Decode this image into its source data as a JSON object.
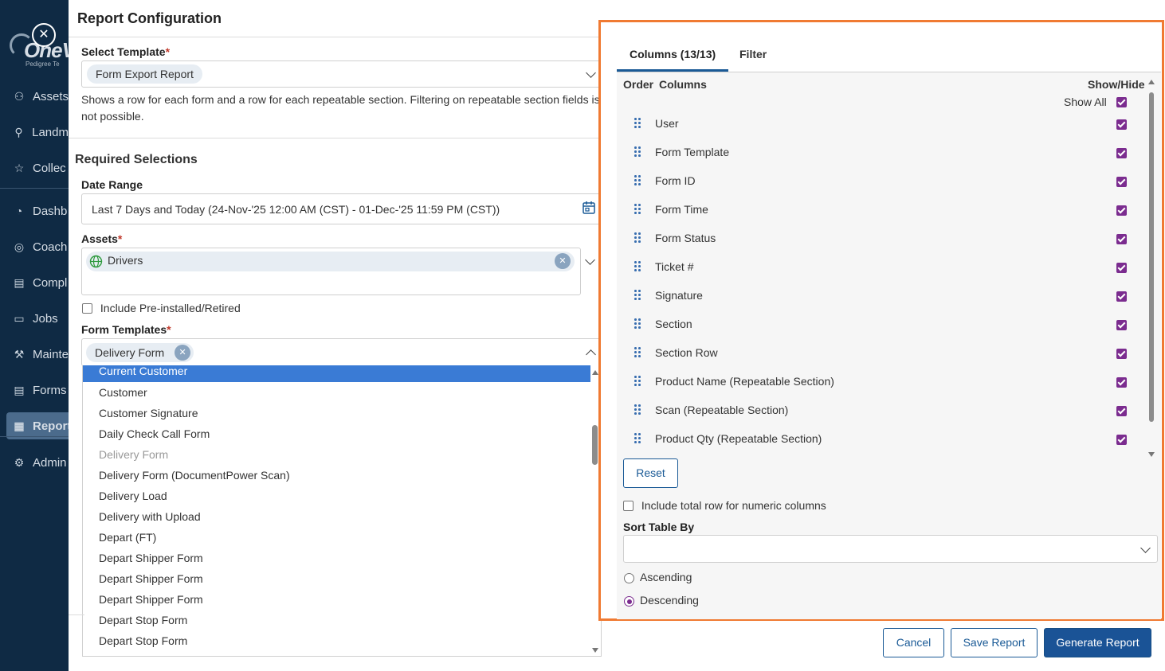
{
  "sidebar": {
    "brand": "OneV",
    "brand_sub": "Pedigree Te",
    "items": [
      {
        "label": "Assets",
        "icon": "assets-icon",
        "glyph": "⚇"
      },
      {
        "label": "Landm",
        "icon": "map-pin-icon",
        "glyph": "⚲"
      },
      {
        "label": "Collec",
        "icon": "star-icon",
        "glyph": "☆"
      },
      {
        "label": "Dashb",
        "icon": "dashboard-icon",
        "glyph": "◔"
      },
      {
        "label": "Coach",
        "icon": "coach-icon",
        "glyph": "◎"
      },
      {
        "label": "Compl",
        "icon": "clipboard-icon",
        "glyph": "▤"
      },
      {
        "label": "Jobs",
        "icon": "briefcase-icon",
        "glyph": "▭"
      },
      {
        "label": "Mainte",
        "icon": "wrench-icon",
        "glyph": "⚒"
      },
      {
        "label": "Forms",
        "icon": "forms-icon",
        "glyph": "▤"
      },
      {
        "label": "Report",
        "icon": "report-icon",
        "glyph": "▦"
      },
      {
        "label": "Admin",
        "icon": "admin-icon",
        "glyph": "⚙"
      }
    ]
  },
  "dialog": {
    "title": "Report Configuration",
    "template": {
      "label": "Select Template",
      "required": "*",
      "value": "Form Export Report",
      "description": "Shows a row for each form and a row for each repeatable section. Filtering on repeatable section fields is not possible."
    },
    "required_selections": "Required Selections",
    "date_range": {
      "label": "Date Range",
      "value": "Last 7 Days and Today (24-Nov-'25 12:00 AM (CST) - 01-Dec-'25 11:59 PM (CST))"
    },
    "assets": {
      "label": "Assets",
      "required": "*",
      "chip": "Drivers",
      "include_label": "Include Pre-installed/Retired"
    },
    "form_templates": {
      "label": "Form Templates",
      "required": "*",
      "chip": "Delivery Form",
      "options": [
        {
          "label": "Current Customer",
          "state": "selected"
        },
        {
          "label": "Customer",
          "state": ""
        },
        {
          "label": "Customer Signature",
          "state": ""
        },
        {
          "label": "Daily Check Call Form",
          "state": ""
        },
        {
          "label": "Delivery Form",
          "state": "disabled"
        },
        {
          "label": "Delivery Form (DocumentPower Scan)",
          "state": ""
        },
        {
          "label": "Delivery Load",
          "state": ""
        },
        {
          "label": "Delivery with Upload",
          "state": ""
        },
        {
          "label": "Depart (FT)",
          "state": ""
        },
        {
          "label": "Depart Shipper Form",
          "state": ""
        },
        {
          "label": "Depart Shipper Form",
          "state": ""
        },
        {
          "label": "Depart Shipper Form",
          "state": ""
        },
        {
          "label": "Depart Stop Form",
          "state": ""
        },
        {
          "label": "Depart Stop Form",
          "state": ""
        }
      ]
    },
    "columns_panel": {
      "tabs": [
        "Columns (13/13)",
        "Filter"
      ],
      "header_order": "Order",
      "header_columns": "Columns",
      "header_show_hide": "Show/Hide",
      "show_all": "Show All",
      "columns": [
        "User",
        "Form Template",
        "Form ID",
        "Form Time",
        "Form Status",
        "Ticket #",
        "Signature",
        "Section",
        "Section Row",
        "Product Name (Repeatable Section)",
        "Scan (Repeatable Section)",
        "Product Qty (Repeatable Section)"
      ],
      "reset": "Reset",
      "include_total": "Include total row for numeric columns",
      "sort_label": "Sort Table By",
      "sort_value": "",
      "ascending": "Ascending",
      "descending": "Descending",
      "sort_direction": "Descending"
    },
    "footer": {
      "cancel": "Cancel",
      "save": "Save Report",
      "generate": "Generate Report"
    }
  },
  "colors": {
    "sidebar_bg": "#0f2a44",
    "accent": "#1a5396",
    "highlight_border": "#f07a32",
    "checkbox": "#7b2c8f",
    "selected_option": "#3a7bd5"
  }
}
